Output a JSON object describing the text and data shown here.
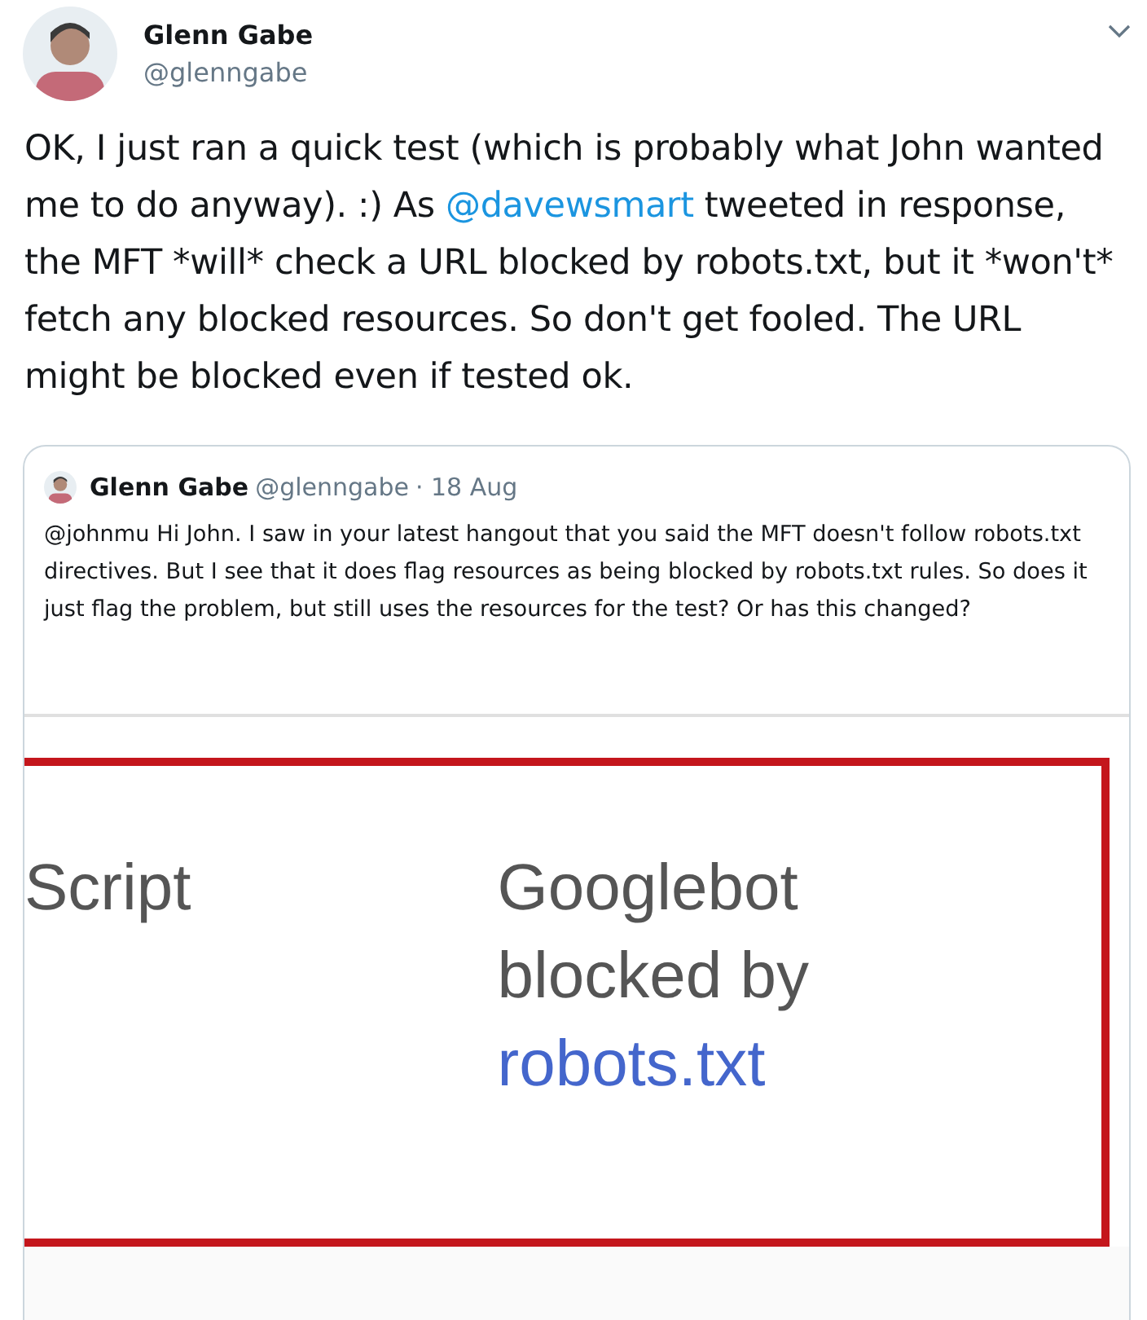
{
  "tweet": {
    "author": {
      "name": "Glenn Gabe",
      "handle": "@glenngabe"
    },
    "text_parts": [
      {
        "kind": "text",
        "text": "OK, I just ran a quick test (which is probably what John wanted me to do anyway). :) As "
      },
      {
        "kind": "mention",
        "text": "@davewsmart"
      },
      {
        "kind": "text",
        "text": " tweeted in response, the MFT *will* check a URL blocked by robots.txt, but it *won't* fetch any blocked resources. So don't get fooled. The URL might be blocked even if tested ok."
      }
    ],
    "quoted_tweet": {
      "author": {
        "name": "Glenn Gabe",
        "handle": "@glenngabe"
      },
      "date": "· 18 Aug",
      "text": "@johnmu Hi John. I saw in your latest hangout that you said the MFT doesn't follow robots.txt directives. But I see that it does flag resources as being blocked by robots.txt rules. So does it just flag the problem, but still uses the resources for the test? Or has this changed?",
      "attached_screenshot": {
        "cells": [
          {
            "lines": [
              "Script"
            ]
          },
          {
            "lines": [
              "Googlebot",
              "blocked by"
            ],
            "link": "robots.txt"
          }
        ]
      }
    }
  }
}
